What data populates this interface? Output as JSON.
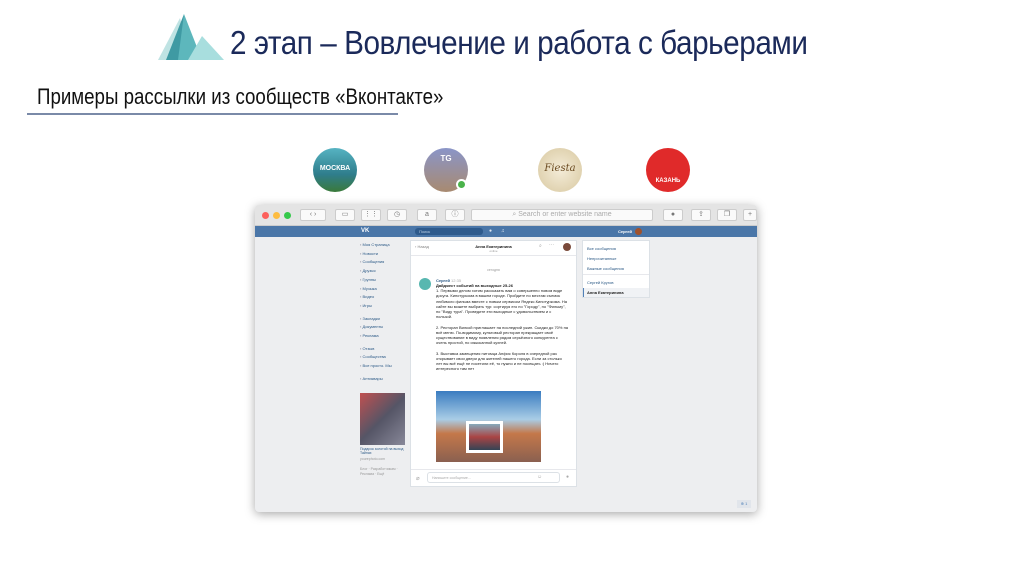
{
  "slide": {
    "title": "2 этап – Вовлечение и работа с барьерами",
    "subtitle": "Примеры рассылки из сообществ «Вконтакте»",
    "accent": "#1b2a5a"
  },
  "communities": [
    {
      "name": "moscow-community",
      "label": "МОСКВА",
      "color": "#2f7d8c"
    },
    {
      "name": "tg-community",
      "label": "TG",
      "color": "#7c8cc0"
    },
    {
      "name": "fiesta-community",
      "label": "Fiesta",
      "color": "#e8dcc0"
    },
    {
      "name": "kazan-community",
      "label": "КАЗАНЬ",
      "color": "#e02a2a"
    }
  ],
  "browser": {
    "address_placeholder": "Search or enter website name"
  },
  "vk": {
    "brand": "VK",
    "search_placeholder": "Поиск",
    "user": "Сергей",
    "color": "#4a76a8",
    "menu": [
      "Моя Страница",
      "Новости",
      "Сообщения",
      "Друзья",
      "Группы",
      "Музыка",
      "Видео",
      "Игры",
      "",
      "Закладки",
      "Документы",
      "Реклама",
      "",
      "Отзыв",
      "Сообщества",
      "Все просто. Мы",
      "",
      "Антиквары"
    ],
    "ad_caption": "Подарок золотой на выход Тайнах",
    "ad_domain": "yourephoto.com",
    "footer": "Блог · Разработчикам · Реклама · Ещё",
    "chat": {
      "back": "Назад",
      "contact": "Анна Екатеринина",
      "status": "online",
      "date": "сегодня",
      "sender": "Сергей",
      "time": "12:35",
      "headline": "Дайджест событий на выходные 25-26",
      "paragraphs": [
        "1. Первыми делом хотим рассказать вам о совершенно новом виде досуга. Кинотуркома в вашем городе. Пройдите по местам съемок любимого фильма вместе с новым сервисом Яндекс.Кинотуркома. На сайте вы можете выбрать тур: сортируя его по \"Городу\", по \"Фильму\", по \"Виду тура\". Проведите эти выходные с удовольствием и с пользой.",
        "2. Ресторан Вилкой приглашает на последний ужин. Скидки до 70% на всё меню. По-видимому, культовый ресторан прекращает своё существование в виду появления рядом серьёзного конкурента с очень простой, но изысканной кухней.",
        "3. Выставка замещения питомца Анфис Короля в очередной раз открывает свои двери для жителей нашего города. Если за столько лет вы всё ещё не посетили её, то нужно и не посещать :) Ничего интересного там нет"
      ],
      "input_placeholder": "Напишите сообщение..."
    },
    "right_panel": [
      "Все сообщения",
      "Непрочитанные",
      "Важные сообщения",
      "Сергей Кругов",
      "Анна Екатеринина"
    ],
    "corner_button": "⊕ 1"
  }
}
